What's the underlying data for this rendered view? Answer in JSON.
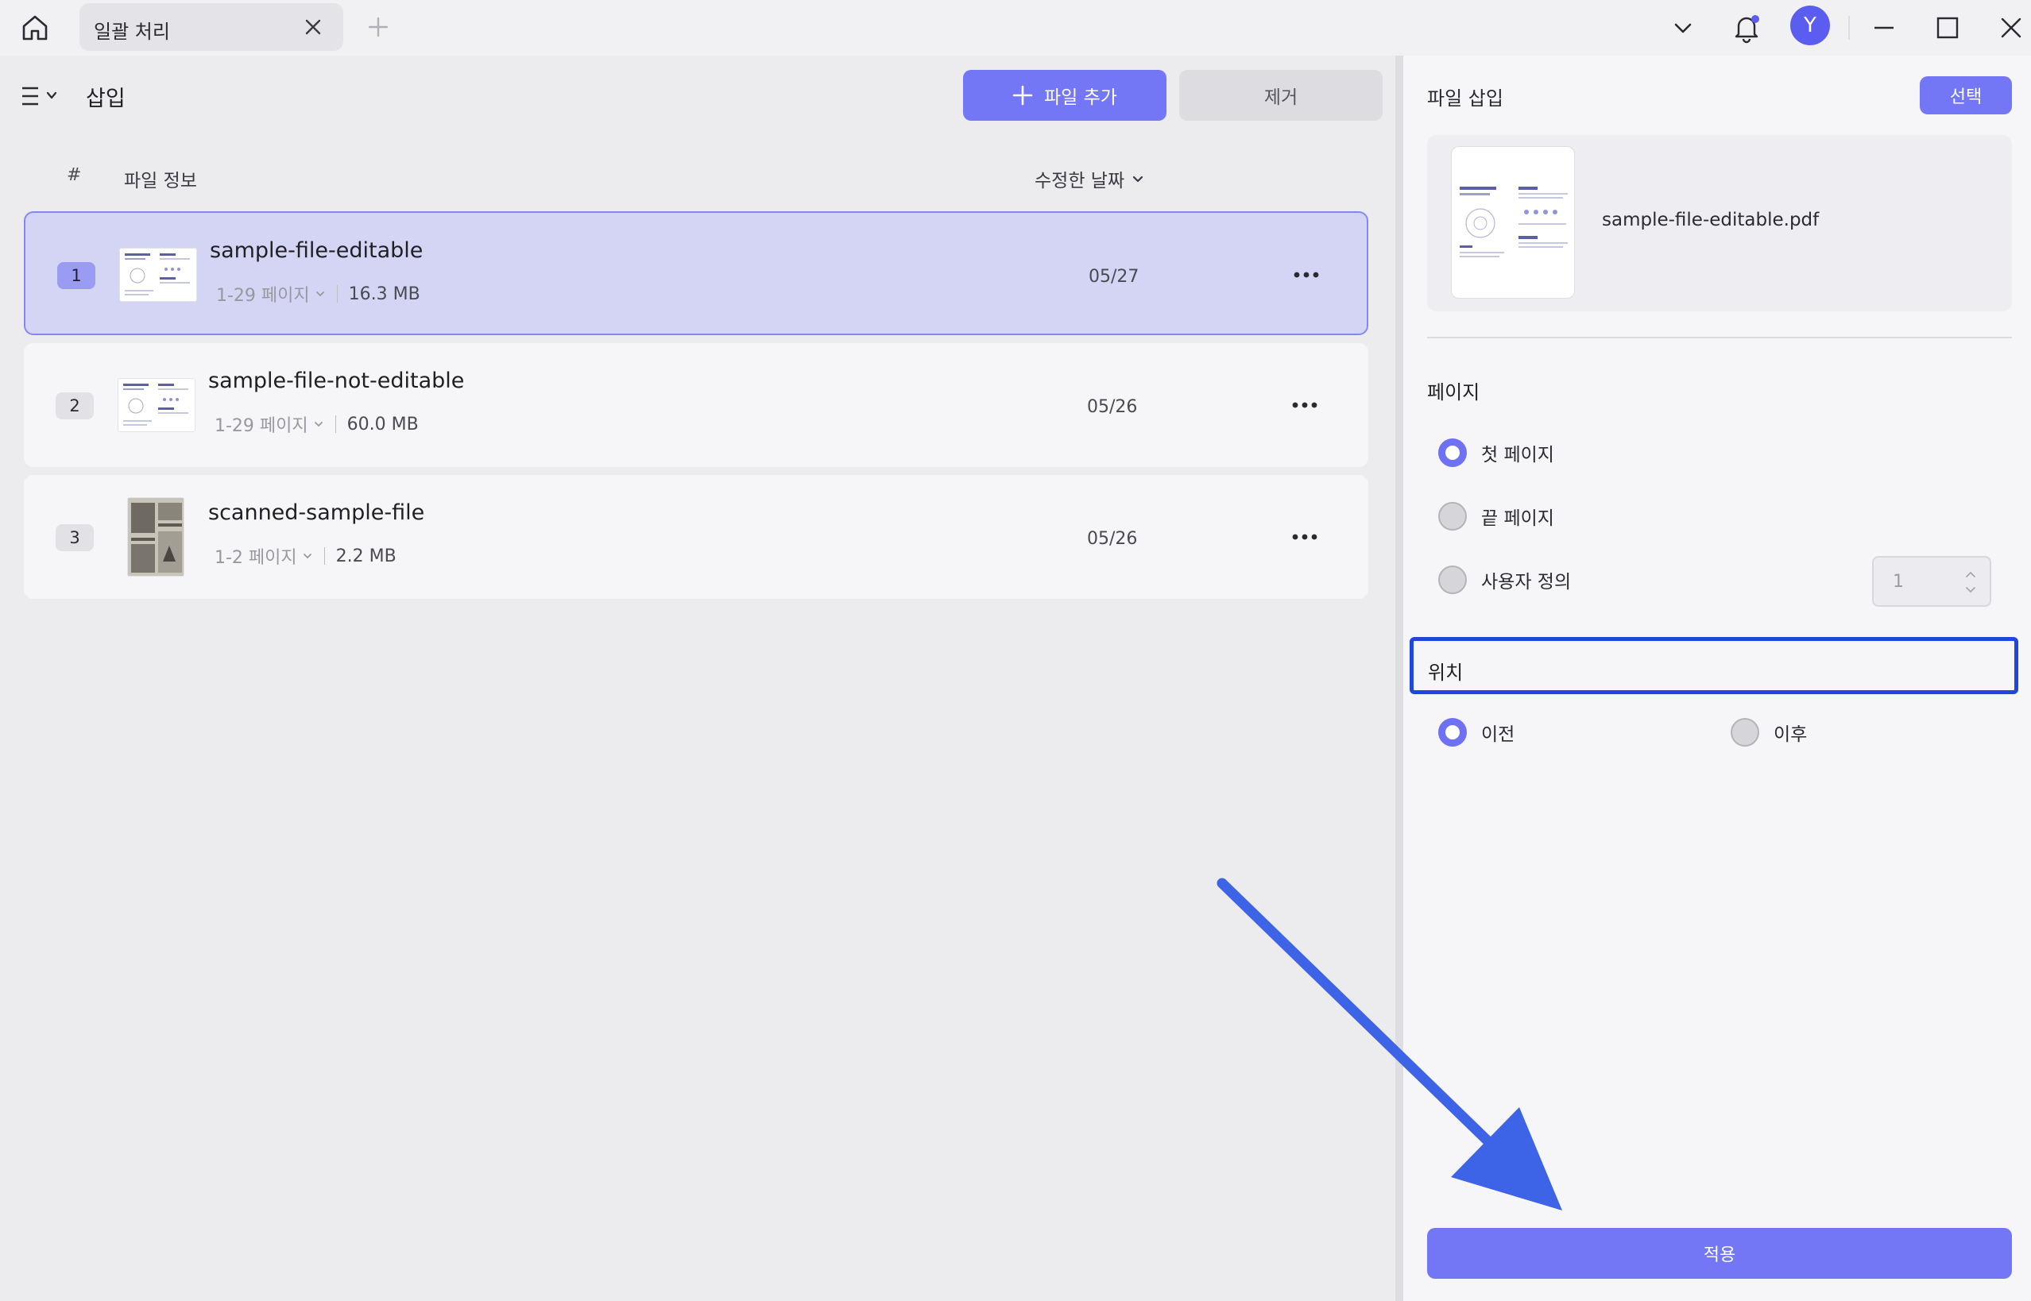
{
  "titlebar": {
    "tab_label": "일괄 처리",
    "avatar_letter": "Y"
  },
  "toolbar": {
    "title": "삽입",
    "add_file_label": "파일 추가",
    "remove_label": "제거"
  },
  "table": {
    "col_number": "#",
    "col_info": "파일 정보",
    "col_date": "수정한 날짜"
  },
  "files": [
    {
      "index": "1",
      "name": "sample-file-editable",
      "pages": "1-29 페이지",
      "size": "16.3 MB",
      "date": "05/27",
      "selected": true
    },
    {
      "index": "2",
      "name": "sample-file-not-editable",
      "pages": "1-29 페이지",
      "size": "60.0 MB",
      "date": "05/26",
      "selected": false
    },
    {
      "index": "3",
      "name": "scanned-sample-file",
      "pages": "1-2 페이지",
      "size": "2.2 MB",
      "date": "05/26",
      "selected": false
    }
  ],
  "insert_panel": {
    "title": "파일 삽입",
    "select_label": "선택",
    "file_name": "sample-file-editable.pdf",
    "page_section": "페이지",
    "page_options": [
      "첫 페이지",
      "끝 페이지",
      "사용자 정의"
    ],
    "page_selected": 0,
    "custom_page_value": "1",
    "position_section": "위치",
    "position_options": [
      "이전",
      "이후"
    ],
    "position_selected": 0,
    "apply_label": "적용"
  },
  "colors": {
    "accent": "#7477f5",
    "selected_row": "#d4d5f4",
    "highlight_border": "#1f47e0",
    "annotation_arrow": "#3d63e6"
  }
}
